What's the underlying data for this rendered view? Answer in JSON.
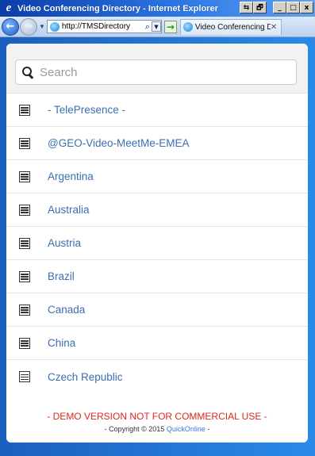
{
  "window": {
    "title": "Video Conferencing Directory - Internet Explorer",
    "controls": [
      "⇆",
      "🗗",
      "_",
      "□",
      "x"
    ]
  },
  "browser": {
    "address": "http://TMSDirectory",
    "tab_title": "Video Conferencing Dir...",
    "tab_close": "✕",
    "go_symbol": "→"
  },
  "search": {
    "placeholder": "Search",
    "value": ""
  },
  "directory": {
    "items": [
      "- TelePresence -",
      "@GEO-Video-MeetMe-EMEA",
      "Argentina",
      "Australia",
      "Austria",
      "Brazil",
      "Canada",
      "China",
      "Czech Republic"
    ]
  },
  "footer": {
    "demo_notice": "- DEMO VERSION NOT FOR COMMERCIAL USE -",
    "copyright_prefix": "- Copyright © 2015 ",
    "copyright_link": "QuickOnline",
    "copyright_suffix": " -"
  },
  "colors": {
    "link": "#3a6fb0",
    "demo_notice": "#e0261b",
    "background": "#1d6fd6"
  }
}
